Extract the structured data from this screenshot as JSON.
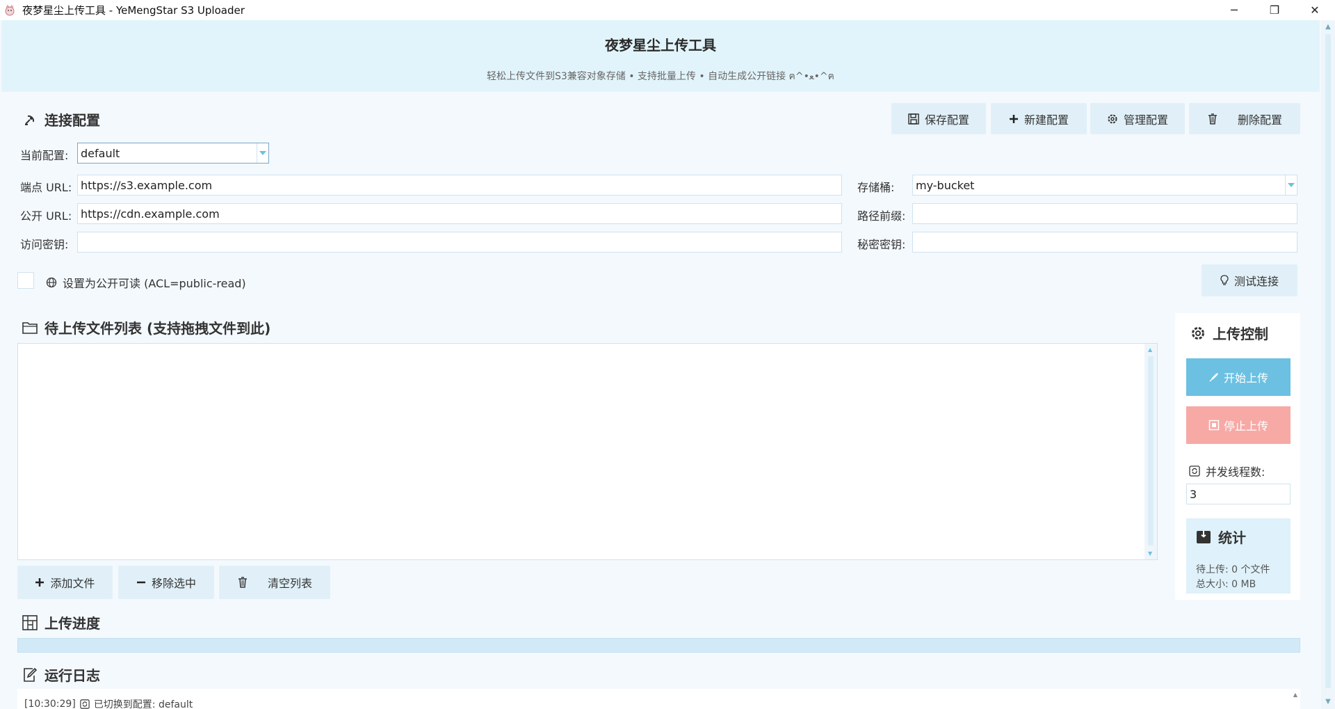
{
  "window": {
    "title": "夜梦星尘上传工具 - YeMengStar S3 Uploader",
    "controls": [
      "─",
      "❐",
      "✕"
    ]
  },
  "header": {
    "title": "夜梦星尘上传工具",
    "subtitle": "轻松上传文件到S3兼容对象存储 • 支持批量上传 • 自动生成公开链接 ฅ^•ﻌ•^ฅ"
  },
  "connection": {
    "section_title": "连接配置",
    "buttons": {
      "save": "保存配置",
      "new": "新建配置",
      "manage": "管理配置",
      "delete": "删除配置",
      "test": "测试连接"
    },
    "current_label": "当前配置:",
    "current_value": "default",
    "endpoint_label": "端点 URL:",
    "endpoint_value": "https://s3.example.com",
    "public_label": "公开 URL:",
    "public_value": "https://cdn.example.com",
    "access_label": "访问密钥:",
    "access_value": "",
    "bucket_label": "存储桶:",
    "bucket_value": "my-bucket",
    "prefix_label": "路径前缀:",
    "prefix_value": "",
    "secret_label": "秘密密钥:",
    "secret_value": "",
    "acl_label": "设置为公开可读 (ACL=public-read)"
  },
  "files": {
    "section_title": "待上传文件列表 (支持拖拽文件到此)",
    "add": "添加文件",
    "remove": "移除选中",
    "clear": "清空列表"
  },
  "control": {
    "title": "上传控制",
    "start": "开始上传",
    "stop": "停止上传",
    "threads_label": "并发线程数:",
    "threads_value": "3",
    "stats_title": "统计",
    "pending": "待上传: 0 个文件",
    "total_size": "总大小: 0 MB"
  },
  "progress": {
    "section_title": "上传进度",
    "value": 0
  },
  "log": {
    "section_title": "运行日志",
    "lines": [
      {
        "time": "[10:30:29]",
        "text": "已切换到配置: default"
      }
    ]
  },
  "colors": {
    "accent": "#6cc0e2",
    "stop": "#f7a9a5",
    "header_bg": "#e2f4fb",
    "button_bg": "#e1f0f8"
  }
}
